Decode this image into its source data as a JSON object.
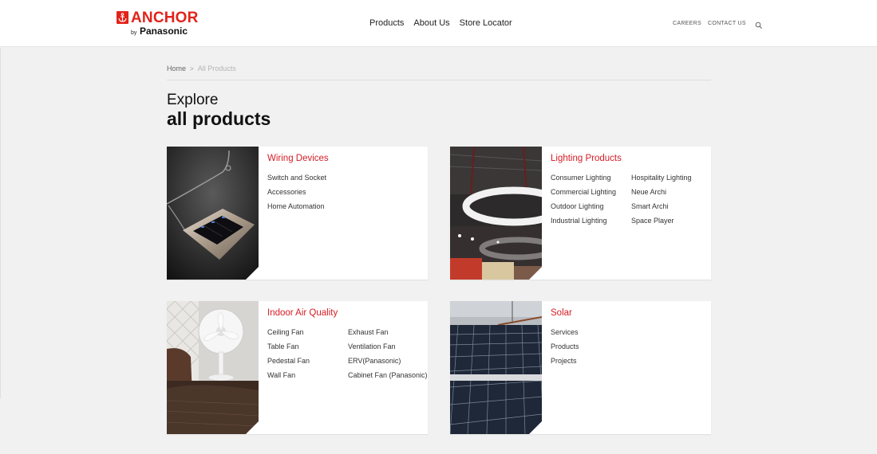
{
  "header": {
    "logo": {
      "brand": "ANCHOR",
      "by": "by",
      "sub": "Panasonic"
    },
    "nav": [
      "Products",
      "About Us",
      "Store Locator"
    ],
    "careers": "CAREERS",
    "contact": "CONTACT US",
    "search_icon": "search-icon"
  },
  "breadcrumb": {
    "home": "Home",
    "separator": ">",
    "current": "All Products"
  },
  "title": {
    "line1": "Explore",
    "line2": "all products"
  },
  "colors": {
    "accent": "#d51d26",
    "brand": "#e2231a",
    "background": "#f1f1f1"
  },
  "categories": [
    {
      "heading": "Wiring Devices",
      "links": [
        "Switch and Socket",
        "Accessories",
        "Home Automation"
      ]
    },
    {
      "heading": "Lighting Products",
      "links": [
        "Consumer Lighting",
        "Hospitality Lighting",
        "Commercial Lighting",
        "Neue Archi",
        "Outdoor Lighting",
        "Smart Archi",
        "Industrial Lighting",
        "Space Player"
      ]
    },
    {
      "heading": "Indoor Air Quality",
      "links": [
        "Ceiling Fan",
        "Exhaust Fan",
        "Table Fan",
        "Ventilation Fan",
        "Pedestal Fan",
        "ERV(Panasonic)",
        "Wall Fan",
        "Cabinet Fan (Panasonic)"
      ]
    },
    {
      "heading": "Solar",
      "links": [
        "Services",
        "Products",
        "Projects"
      ]
    }
  ]
}
